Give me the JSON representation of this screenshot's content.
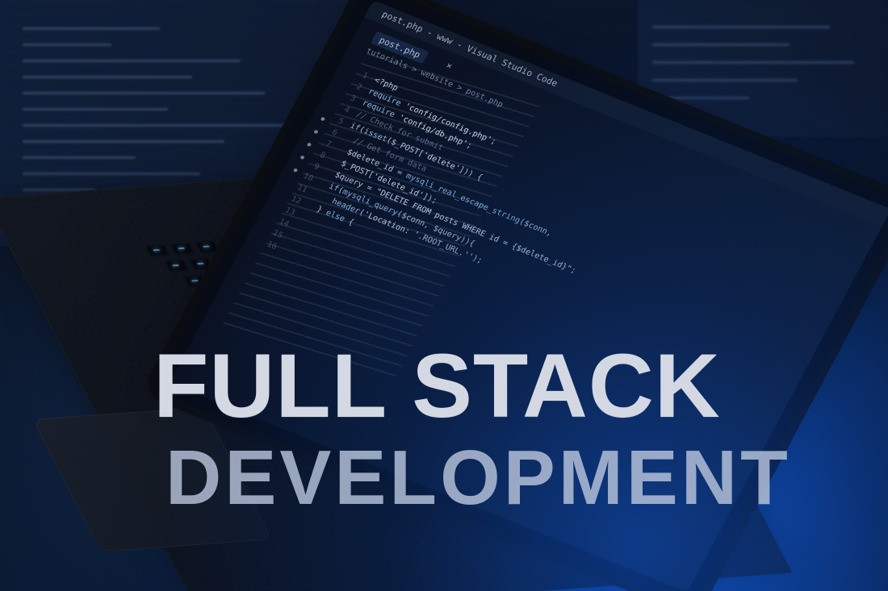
{
  "hero": {
    "headline_primary": "FULL STACK",
    "headline_secondary": "DEVELOPMENT"
  },
  "screen": {
    "window_title": "post.php - www - Visual Studio Code",
    "tab_label": "post.php",
    "tab_close": "×",
    "breadcrumb": "tutorials > website > post.php",
    "line_numbers": [
      "1",
      "2",
      "3",
      "4",
      "5",
      "6",
      "7",
      "8",
      "9",
      "10",
      "11",
      "12",
      "13",
      "14",
      "15",
      "16"
    ],
    "code_lines": [
      "<?php",
      "",
      "require 'config/config.php';",
      "require 'config/db.php';",
      "",
      "// Check for submit",
      "if(isset($_POST['delete'])) {",
      "  // Get form data",
      "  $delete_id = mysqli_real_escape_string($conn,",
      "  $_POST['delete_id']);",
      "",
      "  $query = \"DELETE FROM posts WHERE id = {$delete_id}\";",
      "",
      "  if(mysqli_query($conn, $query)){",
      "    header('Location: '.ROOT_URL.'');",
      "  } else {"
    ]
  },
  "colors": {
    "primary_text": "#d4d8e2",
    "secondary_text": "#b8c4dc",
    "accent_blue": "#1460dc"
  }
}
